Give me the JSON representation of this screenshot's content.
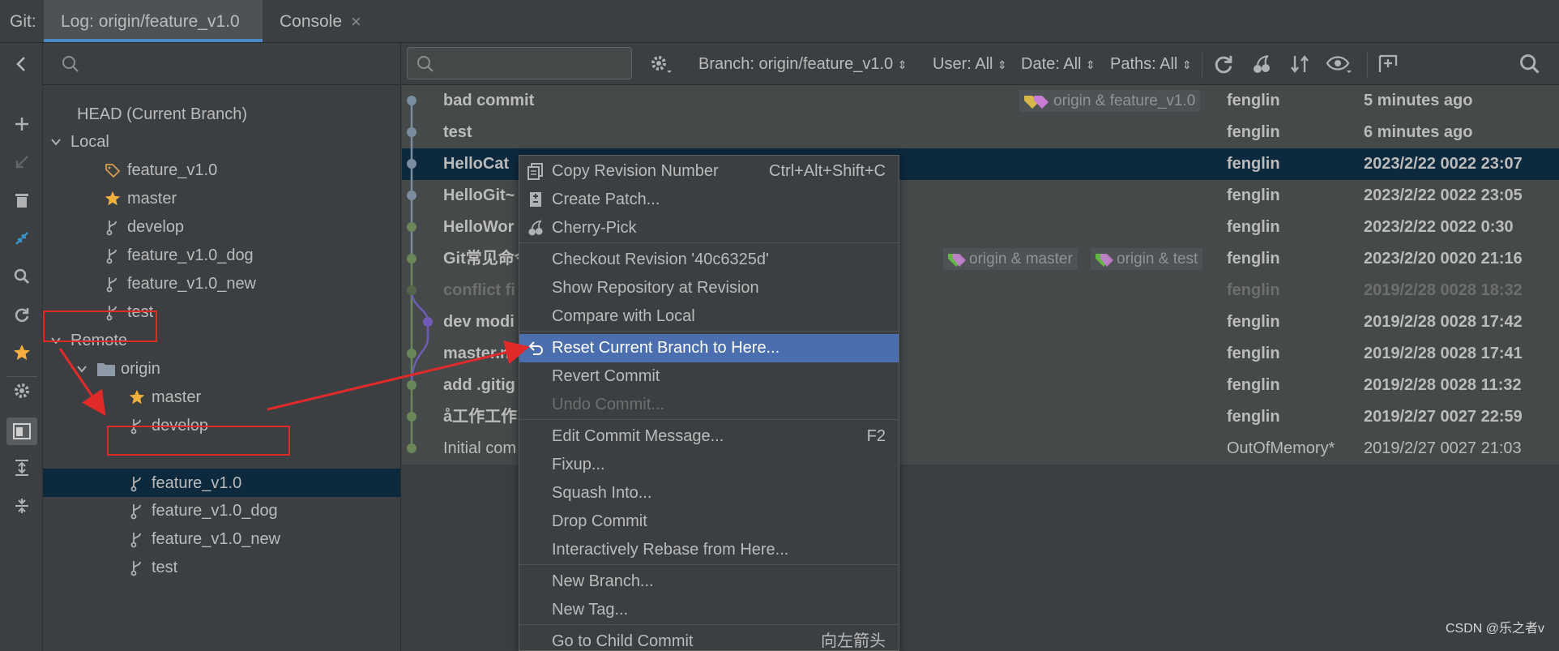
{
  "tabs": {
    "git_label": "Git:",
    "log_tab": "Log: origin/feature_v1.0",
    "console_tab": "Console",
    "close_glyph": "×"
  },
  "left_strip": {
    "icons": [
      "back-arrow-icon",
      "add-icon",
      "checkout-icon",
      "delete-icon",
      "compare-icon",
      "search-icon",
      "refresh-icon",
      "star-icon",
      "settings-icon",
      "panel-toggle-icon",
      "expand-all-icon",
      "collapse-all-icon"
    ]
  },
  "branches": {
    "head": "HEAD (Current Branch)",
    "local_label": "Local",
    "local": [
      "feature_v1.0",
      "master",
      "develop",
      "feature_v1.0_dog",
      "feature_v1.0_new",
      "test"
    ],
    "remote_label": "Remote",
    "origin_label": "origin",
    "remote": [
      "master",
      "develop",
      "feature_v1.0",
      "feature_v1.0_dog",
      "feature_v1.0_new",
      "test"
    ]
  },
  "toolbar": {
    "branch_filter": "Branch: origin/feature_v1.0",
    "user_filter": "User: All",
    "date_filter": "Date: All",
    "paths_filter": "Paths: All",
    "sort_glyph": "⇕"
  },
  "commits": [
    {
      "message": "bad commit",
      "refs": "origin & feature_v1.0",
      "author": "fenglin",
      "date": "5 minutes ago"
    },
    {
      "message": "test",
      "refs": "",
      "author": "fenglin",
      "date": "6 minutes ago"
    },
    {
      "message": "HelloCat",
      "refs": "",
      "author": "fenglin",
      "date": "2023/2/22 0022 23:07"
    },
    {
      "message": "HelloGit~",
      "refs": "",
      "author": "fenglin",
      "date": "2023/2/22 0022 23:05"
    },
    {
      "message": "HelloWor",
      "refs": "",
      "author": "fenglin",
      "date": "2023/2/22 0022 0:30"
    },
    {
      "message": "Git常见命令",
      "refs1": "origin & master",
      "refs2": "origin & test",
      "author": "fenglin",
      "date": "2023/2/20 0020 21:16"
    },
    {
      "message": "conflict fi",
      "refs": "",
      "author": "fenglin",
      "date": "2019/2/28 0028 18:32"
    },
    {
      "message": "dev modi",
      "refs": "",
      "author": "fenglin",
      "date": "2019/2/28 0028 17:42"
    },
    {
      "message": "master.n",
      "refs": "",
      "author": "fenglin",
      "date": "2019/2/28 0028 17:41"
    },
    {
      "message": "add .gitig",
      "refs": "",
      "author": "fenglin",
      "date": "2019/2/28 0028 11:32"
    },
    {
      "message": "å工作工作",
      "refs": "",
      "author": "fenglin",
      "date": "2019/2/27 0027 22:59"
    },
    {
      "message": "Initial com",
      "refs": "",
      "author": "OutOfMemory*",
      "date": "2019/2/27 0027 21:03"
    }
  ],
  "context_menu": {
    "items": [
      {
        "label": "Copy Revision Number",
        "shortcut": "Ctrl+Alt+Shift+C",
        "icon": "copy-icon"
      },
      {
        "label": "Create Patch...",
        "shortcut": "",
        "icon": "patch-icon"
      },
      {
        "label": "Cherry-Pick",
        "shortcut": "",
        "icon": "cherry-icon"
      },
      {
        "label": "Checkout Revision '40c6325d'",
        "shortcut": ""
      },
      {
        "label": "Show Repository at Revision",
        "shortcut": ""
      },
      {
        "label": "Compare with Local",
        "shortcut": ""
      },
      {
        "label": "Reset Current Branch to Here...",
        "shortcut": "",
        "icon": "undo-icon"
      },
      {
        "label": "Revert Commit",
        "shortcut": ""
      },
      {
        "label": "Undo Commit...",
        "shortcut": ""
      },
      {
        "label": "Edit Commit Message...",
        "shortcut": "F2"
      },
      {
        "label": "Fixup...",
        "shortcut": ""
      },
      {
        "label": "Squash Into...",
        "shortcut": ""
      },
      {
        "label": "Drop Commit",
        "shortcut": ""
      },
      {
        "label": "Interactively Rebase from Here...",
        "shortcut": ""
      },
      {
        "label": "New Branch...",
        "shortcut": ""
      },
      {
        "label": "New Tag...",
        "shortcut": ""
      },
      {
        "label": "Go to Child Commit",
        "shortcut": "向左箭头"
      }
    ]
  },
  "watermark": "CSDN @乐之者v",
  "colors": {
    "highlight": "#4b6eaf",
    "selected_row": "#0d293e",
    "annotation_red": "#e02a2a",
    "branch_graph_green": "#6a8759",
    "branch_graph_blue": "#7a8c9e",
    "branch_graph_purple": "#6f5bb5"
  }
}
